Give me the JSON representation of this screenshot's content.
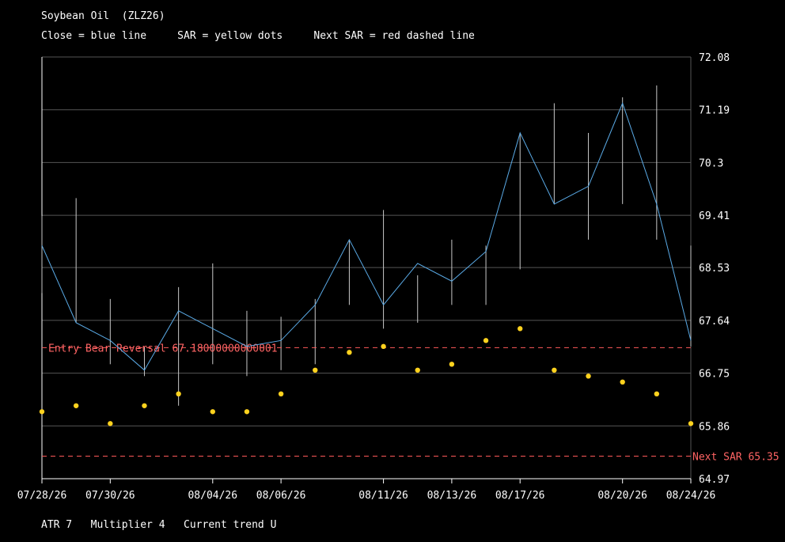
{
  "header": {
    "title": "Soybean Oil  (ZLZ26)",
    "legend": "Close = blue line     SAR = yellow dots     Next SAR = red dashed line"
  },
  "footer": {
    "text": "ATR 7   Multiplier 4   Current trend U"
  },
  "colors": {
    "close": "#5aaae6",
    "sar": "#ffd21e",
    "next_sar": "#ff5a5a",
    "range": "#c8c8c8",
    "grid": "#555555"
  },
  "chart_data": {
    "type": "line",
    "title": "Soybean Oil  (ZLZ26)",
    "ylim": [
      64.97,
      72.08
    ],
    "y_ticks": [
      "72.08",
      "71.19",
      "70.3",
      "69.41",
      "68.53",
      "67.64",
      "66.75",
      "65.86",
      "64.97"
    ],
    "x": [
      "07/28/26",
      "07/29/26",
      "07/30/26",
      "07/31/26",
      "08/03/26",
      "08/04/26",
      "08/05/26",
      "08/06/26",
      "08/07/26",
      "08/10/26",
      "08/11/26",
      "08/12/26",
      "08/13/26",
      "08/14/26",
      "08/17/26",
      "08/18/26",
      "08/19/26",
      "08/20/26",
      "08/21/26",
      "08/24/26"
    ],
    "x_tick_labels": [
      {
        "index": 0,
        "label": "07/28/26"
      },
      {
        "index": 2,
        "label": "07/30/26"
      },
      {
        "index": 5,
        "label": "08/04/26"
      },
      {
        "index": 7,
        "label": "08/06/26"
      },
      {
        "index": 10,
        "label": "08/11/26"
      },
      {
        "index": 12,
        "label": "08/13/26"
      },
      {
        "index": 14,
        "label": "08/17/26"
      },
      {
        "index": 17,
        "label": "08/20/26"
      },
      {
        "index": 19,
        "label": "08/24/26"
      }
    ],
    "series": [
      {
        "type": "range",
        "high": [
          69.4,
          69.7,
          68.0,
          67.2,
          68.2,
          68.6,
          67.8,
          67.7,
          68.0,
          69.0,
          69.5,
          68.4,
          69.0,
          68.9,
          70.8,
          71.3,
          70.8,
          71.4,
          71.6,
          68.9
        ],
        "low": [
          68.1,
          67.6,
          66.9,
          66.7,
          66.2,
          66.9,
          66.7,
          66.8,
          66.9,
          67.9,
          67.5,
          67.6,
          67.9,
          67.9,
          68.5,
          69.6,
          69.0,
          69.6,
          69.0,
          67.2
        ]
      },
      {
        "type": "line",
        "values": [
          68.9,
          67.6,
          67.3,
          66.8,
          67.8,
          67.5,
          67.2,
          67.3,
          67.9,
          69.0,
          67.9,
          68.6,
          68.3,
          68.8,
          70.8,
          69.6,
          69.9,
          71.3,
          69.6,
          67.3
        ]
      },
      {
        "type": "scatter",
        "values": [
          66.1,
          66.2,
          65.9,
          66.2,
          66.4,
          66.1,
          66.1,
          66.4,
          66.8,
          67.1,
          67.2,
          66.8,
          66.9,
          67.3,
          67.5,
          66.8,
          66.7,
          66.6,
          66.4,
          65.9
        ]
      }
    ],
    "annotations": [
      {
        "label": "Entry Bear Reversal 67.18000000000001",
        "value": 67.18
      },
      {
        "label": "Next SAR 65.35",
        "value": 65.35
      }
    ]
  }
}
